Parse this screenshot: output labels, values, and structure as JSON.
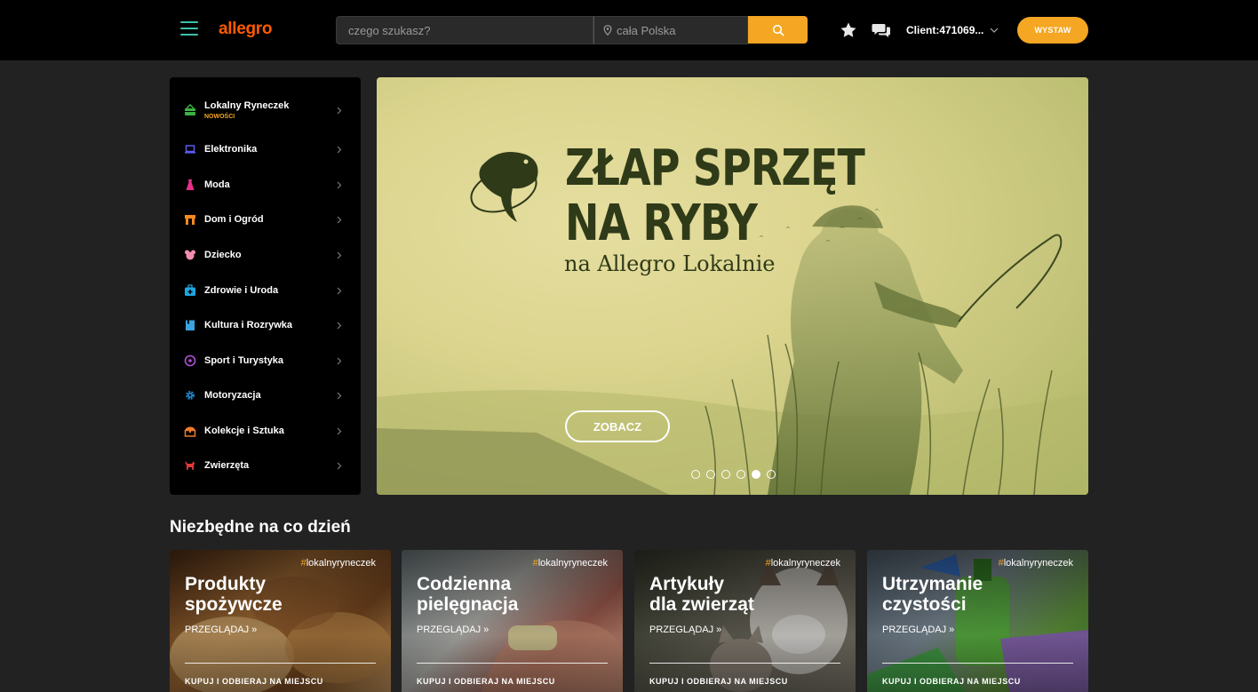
{
  "header": {
    "logo": "allegro",
    "search_placeholder": "czego szukasz?",
    "location": "cała Polska",
    "client": "Client:471069...",
    "sell_button": "WYSTAW"
  },
  "sidebar": {
    "items": [
      {
        "label": "Lokalny Ryneczek",
        "badge": "NOWOŚCI",
        "icon": "basket-icon",
        "color": "#3cb043"
      },
      {
        "label": "Elektronika",
        "icon": "laptop-icon",
        "color": "#5b5bf0"
      },
      {
        "label": "Moda",
        "icon": "dress-icon",
        "color": "#e8308a"
      },
      {
        "label": "Dom i Ogród",
        "icon": "house-icon",
        "color": "#f58a1f"
      },
      {
        "label": "Dziecko",
        "icon": "teddy-icon",
        "color": "#f28db2"
      },
      {
        "label": "Zdrowie i Uroda",
        "icon": "medkit-icon",
        "color": "#1fa6e0"
      },
      {
        "label": "Kultura i Rozrywka",
        "icon": "book-icon",
        "color": "#3aa3e0"
      },
      {
        "label": "Sport i Turystyka",
        "icon": "ball-icon",
        "color": "#b04fd8"
      },
      {
        "label": "Motoryzacja",
        "icon": "gear-icon",
        "color": "#1e7fc0"
      },
      {
        "label": "Kolekcje i Sztuka",
        "icon": "chest-icon",
        "color": "#f07b2a"
      },
      {
        "label": "Zwierzęta",
        "icon": "dog-icon",
        "color": "#e03a3a"
      }
    ]
  },
  "banner": {
    "title_line1": "ZŁAP SPRZĘT",
    "title_line2": "NA RYBY",
    "subtitle": "na Allegro Lokalnie",
    "cta": "ZOBACZ",
    "slides": 6,
    "active_slide": 5
  },
  "section": {
    "title": "Niezbędne na co dzień",
    "cards": [
      {
        "tag_hash": "#",
        "tag": "lokalnyryneczek",
        "title_line1": "Produkty",
        "title_line2": "spożywcze",
        "more": "PRZEGLĄDAJ »",
        "footer": "KUPUJ I ODBIERAJ NA MIEJSCU"
      },
      {
        "tag_hash": "#",
        "tag": "lokalnyryneczek",
        "title_line1": "Codzienna",
        "title_line2": "pielęgnacja",
        "more": "PRZEGLĄDAJ »",
        "footer": "KUPUJ I ODBIERAJ NA MIEJSCU"
      },
      {
        "tag_hash": "#",
        "tag": "lokalnyryneczek",
        "title_line1": "Artykuły",
        "title_line2": "dla zwierząt",
        "more": "PRZEGLĄDAJ »",
        "footer": "KUPUJ I ODBIERAJ NA MIEJSCU"
      },
      {
        "tag_hash": "#",
        "tag": "lokalnyryneczek",
        "title_line1": "Utrzymanie",
        "title_line2": "czystości",
        "more": "PRZEGLĄDAJ »",
        "footer": "KUPUJ I ODBIERAJ NA MIEJSCU"
      }
    ]
  },
  "colors": {
    "accent": "#f5a623",
    "brand": "#ff5a00",
    "menu": "#3cc0a8"
  }
}
